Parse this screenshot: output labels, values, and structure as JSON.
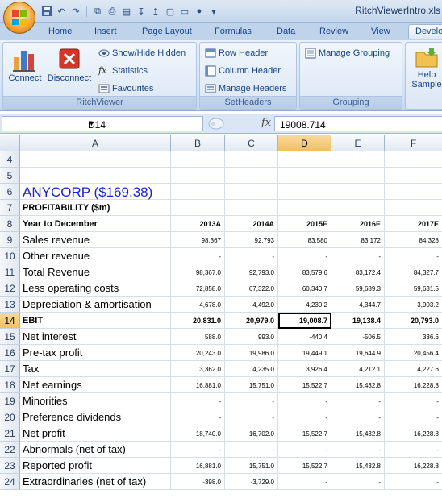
{
  "window": {
    "title": "RitchViewerIntro.xls"
  },
  "tabs": [
    "Home",
    "Insert",
    "Page Layout",
    "Formulas",
    "Data",
    "Review",
    "View",
    "Develo"
  ],
  "ribbon": {
    "connect_label": "Connect",
    "disconnect_label": "Disconnect",
    "show_hide_label": "Show/Hide Hidden",
    "statistics_label": "Statistics",
    "favourites_label": "Favourites",
    "ritchviewer_group": "RitchViewer",
    "row_header_label": "Row Header",
    "column_header_label": "Column Header",
    "manage_headers_label": "Manage Headers",
    "setheaders_group": "SetHeaders",
    "manage_grouping_label": "Manage Grouping",
    "grouping_group": "Grouping",
    "help_label": "Help",
    "samples_label": "Sample"
  },
  "formula_bar": {
    "name_box": "D14",
    "fx": "fx",
    "value": "19008.714"
  },
  "columns": [
    "A",
    "B",
    "C",
    "D",
    "E",
    "F"
  ],
  "sheet": {
    "rows": [
      {
        "n": "4",
        "label": "",
        "values": [
          "",
          "",
          "",
          "",
          ""
        ]
      },
      {
        "n": "5",
        "label": "",
        "values": [
          "",
          "",
          "",
          "",
          ""
        ]
      },
      {
        "n": "6",
        "label": "ANYCORP  ($169.38)",
        "style": "title",
        "values": [
          "",
          "",
          "",
          "",
          ""
        ]
      },
      {
        "n": "7",
        "label": "PROFITABILITY ($m)",
        "style": "bold",
        "values": [
          "",
          "",
          "",
          "",
          ""
        ]
      },
      {
        "n": "8",
        "label": "Year to December",
        "style": "bold",
        "header": true,
        "values": [
          "2013A",
          "2014A",
          "2015E",
          "2016E",
          "2017E"
        ]
      },
      {
        "n": "9",
        "label": "Sales revenue",
        "values": [
          "98,367",
          "92,793",
          "83,580",
          "83,172",
          "84,328"
        ]
      },
      {
        "n": "10",
        "label": "Other revenue",
        "values": [
          "-",
          "-",
          "-",
          "-",
          "-"
        ]
      },
      {
        "n": "11",
        "label": "Total Revenue",
        "values": [
          "98,367.0",
          "92,793.0",
          "83,579.6",
          "83,172.4",
          "84,327.7"
        ]
      },
      {
        "n": "12",
        "label": "Less operating costs",
        "values": [
          "72,858.0",
          "67,322.0",
          "60,340.7",
          "59,689.3",
          "59,631.5"
        ]
      },
      {
        "n": "13",
        "label": "Depreciation & amortisation",
        "values": [
          "4,678.0",
          "4,492.0",
          "4,230.2",
          "4,344.7",
          "3,903.2"
        ]
      },
      {
        "n": "14",
        "label": "EBIT",
        "style": "bold",
        "boldvals": true,
        "values": [
          "20,831.0",
          "20,979.0",
          "19,008.7",
          "19,138.4",
          "20,793.0"
        ]
      },
      {
        "n": "15",
        "label": "Net interest",
        "values": [
          "588.0",
          "993.0",
          "-440.4",
          "-506.5",
          "336.6"
        ]
      },
      {
        "n": "16",
        "label": "Pre-tax profit",
        "values": [
          "20,243.0",
          "19,986.0",
          "19,449.1",
          "19,644.9",
          "20,456.4"
        ]
      },
      {
        "n": "17",
        "label": "Tax",
        "values": [
          "3,362.0",
          "4,235.0",
          "3,926.4",
          "4,212.1",
          "4,227.6"
        ]
      },
      {
        "n": "18",
        "label": "Net earnings",
        "values": [
          "16,881.0",
          "15,751.0",
          "15,522.7",
          "15,432.8",
          "16,228.8"
        ]
      },
      {
        "n": "19",
        "label": "Minorities",
        "values": [
          "-",
          "-",
          "-",
          "-",
          "-"
        ]
      },
      {
        "n": "20",
        "label": "Preference dividends",
        "values": [
          "-",
          "-",
          "-",
          "-",
          "-"
        ]
      },
      {
        "n": "21",
        "label": "Net profit",
        "values": [
          "18,740.0",
          "16,702.0",
          "15,522.7",
          "15,432.8",
          "16,228.8"
        ]
      },
      {
        "n": "22",
        "label": "Abnormals (net of tax)",
        "values": [
          "-",
          "-",
          "-",
          "-",
          "-"
        ]
      },
      {
        "n": "23",
        "label": "Reported profit",
        "values": [
          "16,881.0",
          "15,751.0",
          "15,522.7",
          "15,432.8",
          "16,228.8"
        ]
      },
      {
        "n": "24",
        "label": "Extraordinaries (net of tax)",
        "values": [
          "-398.0",
          "-3,729.0",
          "-",
          "-",
          "-"
        ]
      }
    ]
  },
  "selection": {
    "row": "14",
    "column": "D"
  },
  "colors": {
    "title_text": "#1a22d0",
    "selection_header": "#f1c15f",
    "ribbon_bg": "#d3e2f3"
  }
}
